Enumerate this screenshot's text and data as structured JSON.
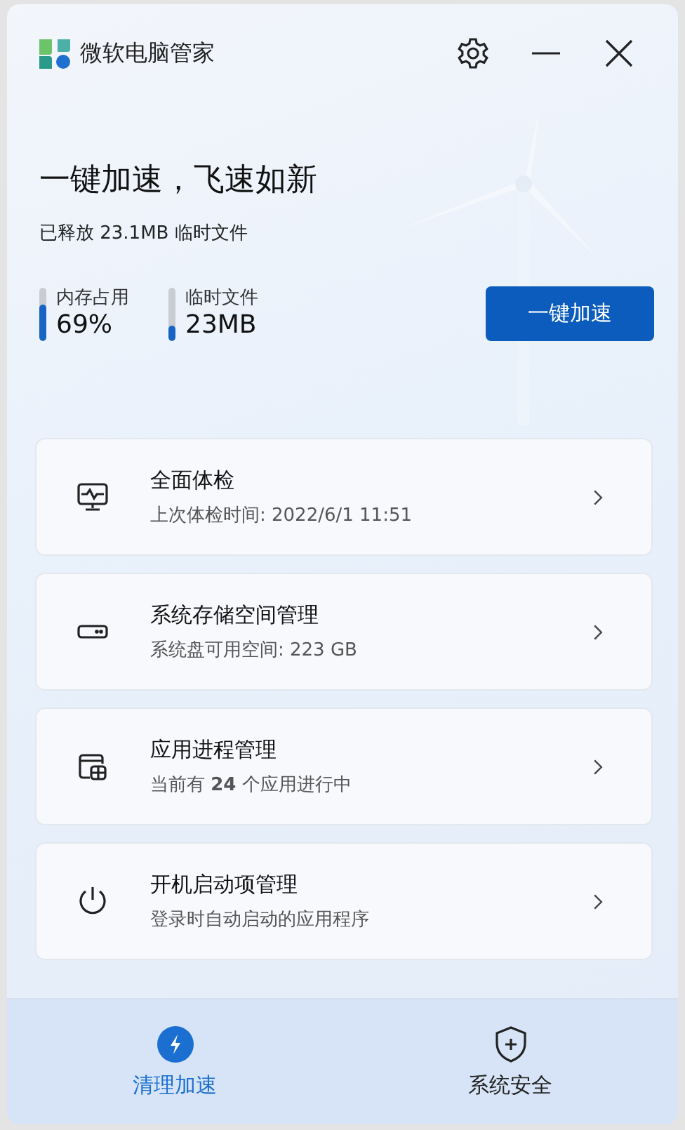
{
  "window": {
    "title": "微软电脑管家"
  },
  "hero": {
    "title": "一键加速，飞速如新",
    "subtitle": "已释放 23.1MB 临时文件",
    "button": "一键加速"
  },
  "meters": [
    {
      "label": "内存占用",
      "value": "69%",
      "level": 0.69
    },
    {
      "label": "临时文件",
      "value": "23MB",
      "level": 0.3
    }
  ],
  "cards": [
    {
      "kind": "checkup",
      "title": "全面体检",
      "subtitle": "上次体检时间: 2022/6/1 11:51"
    },
    {
      "kind": "storage",
      "title": "系统存储空间管理",
      "subtitle": "系统盘可用空间: 223 GB"
    },
    {
      "kind": "process",
      "title": "应用进程管理",
      "subtitle": "当前有 **24** 个应用进行中"
    },
    {
      "kind": "startup",
      "title": "开机启动项管理",
      "subtitle": "登录时自动启动的应用程序"
    }
  ],
  "nav": [
    {
      "kind": "boost",
      "label": "清理加速",
      "selected": true
    },
    {
      "kind": "security",
      "label": "系统安全",
      "selected": false
    }
  ]
}
